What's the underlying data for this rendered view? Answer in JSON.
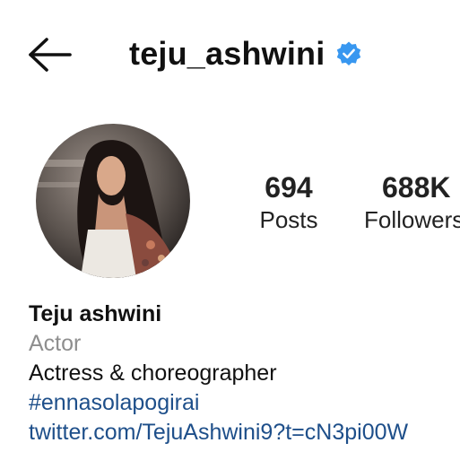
{
  "header": {
    "back_icon": "arrow-left-icon",
    "username": "teju_ashwini",
    "verified_icon": "verified-badge-icon",
    "verified_color": "#3897f0"
  },
  "profile": {
    "avatar_icon": "profile-photo",
    "stats": [
      {
        "value": "694",
        "label": "Posts"
      },
      {
        "value": "688K",
        "label": "Followers"
      }
    ]
  },
  "bio": {
    "name": "Teju ashwini",
    "category": "Actor",
    "text": "Actress & choreographer",
    "hashtag": "#ennasolapogirai",
    "link": "twitter.com/TejuAshwini9?t=cN3pi00W"
  },
  "colors": {
    "link": "#1e4f8a",
    "category": "#8e8e8e",
    "text": "#111111"
  }
}
